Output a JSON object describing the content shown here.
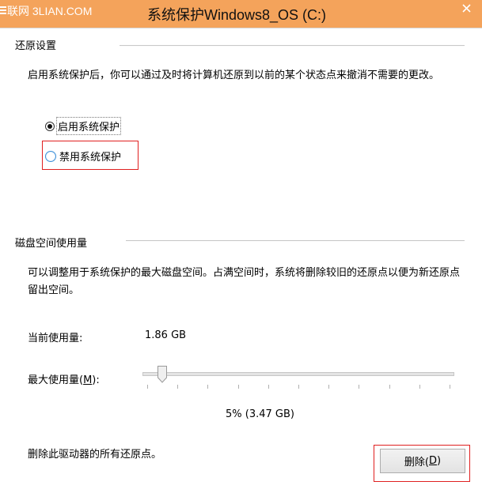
{
  "window": {
    "title": "系统保护Windows8_OS (C:)",
    "watermark": "联网 3LIAN.COM"
  },
  "restore_settings": {
    "heading": "还原设置",
    "description": "启用系统保护后，你可以通过及时将计算机还原到以前的某个状态点来撤消不需要的更改。",
    "options": [
      {
        "label": "启用系统保护",
        "checked": true
      },
      {
        "label": "禁用系统保护",
        "checked": false
      }
    ]
  },
  "disk_usage": {
    "heading": "磁盘空间使用量",
    "description": "可以调整用于系统保护的最大磁盘空间。占满空间时，系统将删除较旧的还原点以便为新还原点留出空间。",
    "current_label": "当前使用量:",
    "current_value": "1.86 GB",
    "max_label_prefix": "最大使用量(",
    "max_label_mnemonic": "M",
    "max_label_suffix": "):",
    "slider_percent": 5,
    "slider_readout": "5% (3.47 GB)",
    "delete_description": "删除此驱动器的所有还原点。",
    "delete_button_prefix": "删除(",
    "delete_button_mnemonic": "D",
    "delete_button_suffix": ")"
  },
  "colors": {
    "titlebar": "#f4a35b",
    "highlight": "#e02020",
    "radio_focus": "#3b8fd8"
  }
}
